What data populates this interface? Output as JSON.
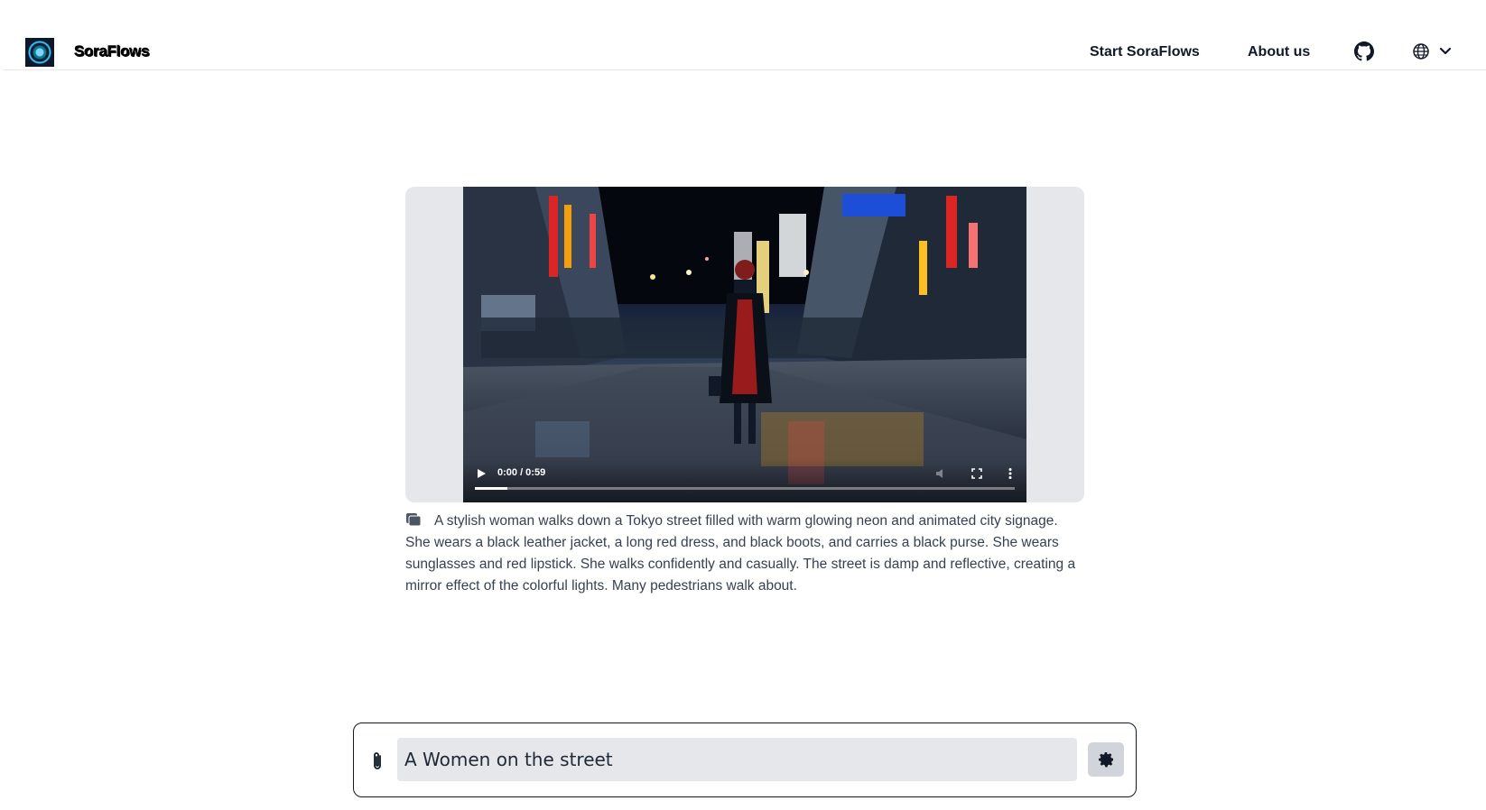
{
  "header": {
    "brand": "SoraFlows",
    "nav": {
      "start_label": "Start SoraFlows",
      "about_label": "About us"
    },
    "icons": {
      "github": "github-icon",
      "language": "globe-icon",
      "language_chevron": "chevron-down-icon"
    }
  },
  "video": {
    "time": "0:00 / 0:59",
    "progress": 0.06,
    "controls": [
      "play-icon",
      "volume-icon",
      "fullscreen-icon",
      "more-vertical-icon"
    ]
  },
  "description": {
    "text": "A stylish woman walks down a Tokyo street filled with warm glowing neon and animated city signage. She wears a black leather jacket, a long red dress, and black boots, and carries a black purse. She wears sunglasses and red lipstick. She walks confidently and casually. The street is damp and reflective, creating a mirror effect of the colorful lights. Many pedestrians walk about."
  },
  "prompt": {
    "value": "A Women on the street"
  },
  "colors": {
    "card_bg": "#e5e7eb",
    "input_bg": "#e5e7eb",
    "text": "#1f2937"
  }
}
